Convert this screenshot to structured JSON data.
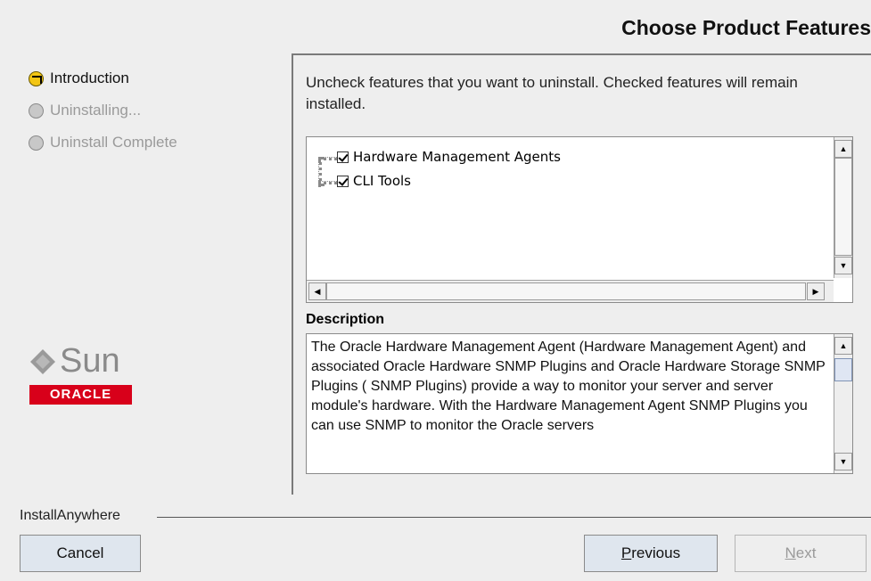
{
  "header": {
    "title": "Choose Product Features"
  },
  "steps": [
    {
      "label": "Introduction",
      "state": "current"
    },
    {
      "label": "Uninstalling...",
      "state": "pending"
    },
    {
      "label": "Uninstall Complete",
      "state": "pending"
    }
  ],
  "branding": {
    "sun_text": "Sun",
    "oracle_text": "ORACLE",
    "installer_name": "InstallAnywhere",
    "oracle_color": "#d8001a"
  },
  "main": {
    "instructions": "Uncheck features that you want to uninstall. Checked features will remain installed.",
    "features": [
      {
        "label": "Hardware Management Agents",
        "checked": true
      },
      {
        "label": "CLI Tools",
        "checked": true
      }
    ],
    "description_label": "Description",
    "description_text": "The Oracle Hardware Management Agent (Hardware Management Agent) and associated Oracle Hardware SNMP Plugins and Oracle Hardware Storage SNMP Plugins ( SNMP Plugins) provide a way to monitor your server and server module's hardware. With the Hardware Management Agent SNMP Plugins you can use SNMP to monitor the Oracle servers"
  },
  "buttons": {
    "cancel": "Cancel",
    "previous_underlined": "P",
    "previous_rest": "revious",
    "next_underlined": "N",
    "next_rest": "ext"
  },
  "icons": {
    "current_step": "arrow-right-circle-icon",
    "pending_step": "gray-circle-icon",
    "sun_logo": "sun-diamond-icon",
    "scroll_up": "arrow-up-icon",
    "scroll_down": "arrow-down-icon",
    "scroll_left": "arrow-left-icon",
    "scroll_right": "arrow-right-icon"
  }
}
